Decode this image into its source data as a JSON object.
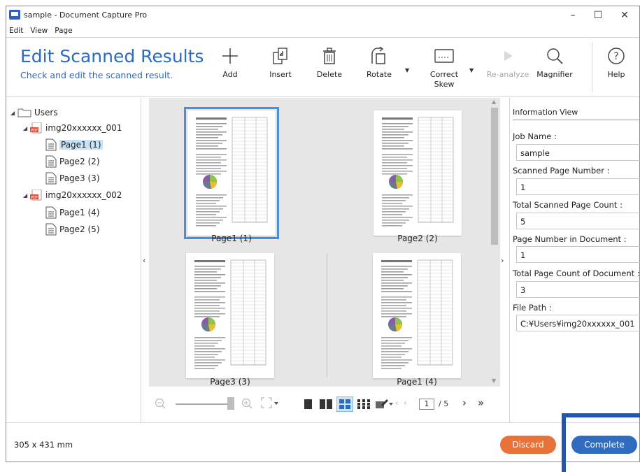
{
  "window": {
    "title": "sample - Document Capture Pro"
  },
  "menu": [
    "Edit",
    "View",
    "Page"
  ],
  "ribbon": {
    "title": "Edit Scanned Results",
    "subtitle": "Check and edit the scanned result.",
    "tools": {
      "add": "Add",
      "insert": "Insert",
      "delete": "Delete",
      "rotate": "Rotate",
      "correct_skew_1": "Correct",
      "correct_skew_2": "Skew",
      "reanalyze": "Re-analyze",
      "magnifier": "Magnifier",
      "help": "Help"
    }
  },
  "tree": {
    "root": "Users",
    "docs": [
      {
        "name": "img20xxxxxx_001",
        "pages": [
          "Page1 (1)",
          "Page2 (2)",
          "Page3 (3)"
        ]
      },
      {
        "name": "img20xxxxxx_002",
        "pages": [
          "Page1 (4)",
          "Page2 (5)"
        ]
      }
    ]
  },
  "thumbnails": [
    "Page1 (1)",
    "Page2 (2)",
    "Page3 (3)",
    "Page1 (4)"
  ],
  "pager": {
    "current": "1",
    "total": "/ 5"
  },
  "info": {
    "header": "Information View",
    "job_name_label": "Job Name :",
    "job_name": "sample",
    "scanned_page_label": "Scanned Page Number :",
    "scanned_page": "1",
    "total_scanned_label": "Total Scanned Page Count :",
    "total_scanned": "5",
    "page_in_doc_label": "Page Number in Document :",
    "page_in_doc": "1",
    "total_doc_label": "Total Page Count of Document :",
    "total_doc": "3",
    "file_path_label": "File Path :",
    "file_path": "C:¥Users¥img20xxxxxx_001"
  },
  "status": {
    "dimensions": "305 x 431 mm"
  },
  "buttons": {
    "discard": "Discard",
    "complete": "Complete"
  },
  "colors": {
    "accent": "#2a6bc3",
    "discard": "#e8733a",
    "complete": "#2f6cbf",
    "selection": "#4a90d9"
  }
}
